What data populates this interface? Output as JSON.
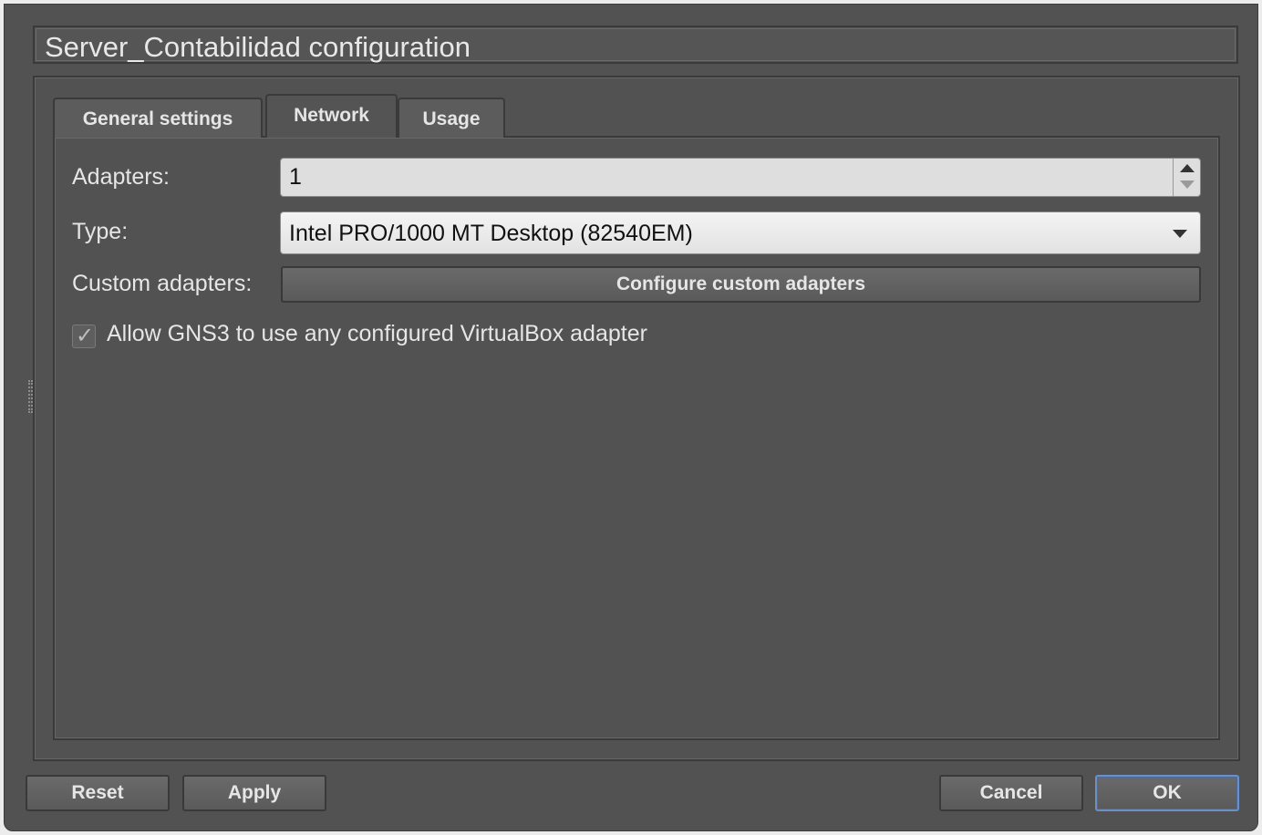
{
  "dialog": {
    "title": "Server_Contabilidad configuration"
  },
  "tabs": [
    {
      "label": "General settings",
      "active": false
    },
    {
      "label": "Network",
      "active": true
    },
    {
      "label": "Usage",
      "active": false
    }
  ],
  "network": {
    "adapters_label": "Adapters:",
    "adapters_value": "1",
    "type_label": "Type:",
    "type_value": "Intel PRO/1000 MT Desktop (82540EM)",
    "custom_label": "Custom adapters:",
    "configure_button_label": "Configure custom adapters",
    "allow_checkbox_label": "Allow GNS3 to use any configured VirtualBox adapter",
    "allow_checkbox_checked": true
  },
  "buttons": {
    "reset": "Reset",
    "apply": "Apply",
    "cancel": "Cancel",
    "ok": "OK"
  },
  "icons": {
    "spin_up": "chevron-up-icon",
    "spin_down": "chevron-down-icon",
    "combo_arrow": "dropdown-arrow-icon",
    "check": "checkmark-icon"
  }
}
